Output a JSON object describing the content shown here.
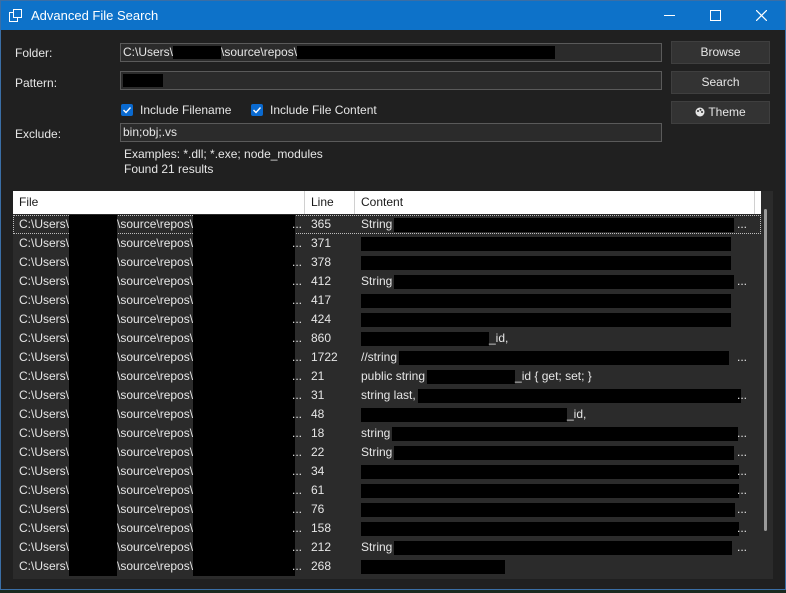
{
  "window": {
    "title": "Advanced File Search",
    "accent": "#0d72c9"
  },
  "form": {
    "folder_label": "Folder:",
    "folder_prefix": "C:\\Users\\",
    "folder_mid": "\\source\\repos\\",
    "pattern_label": "Pattern:",
    "exclude_label": "Exclude:",
    "exclude_value": "bin;obj;.vs",
    "include_filename_label": "Include Filename",
    "include_filename_checked": true,
    "include_content_label": "Include File Content",
    "include_content_checked": true,
    "examples_text": "Examples: *.dll; *.exe; node_modules",
    "results_text": "Found 21 results"
  },
  "buttons": {
    "browse": "Browse",
    "search": "Search",
    "theme": "Theme"
  },
  "table": {
    "columns": [
      "File",
      "Line",
      "Content"
    ],
    "file_prefix": "C:\\Users\\",
    "file_mid": "\\source\\repos\\",
    "ellipsis": "...",
    "rows": [
      {
        "line": "365",
        "pre": "String",
        "post": "",
        "ell": true
      },
      {
        "line": "371",
        "pre": "",
        "post": "",
        "ell": false
      },
      {
        "line": "378",
        "pre": "",
        "post": "",
        "ell": false
      },
      {
        "line": "412",
        "pre": "String",
        "post": "",
        "ell": true
      },
      {
        "line": "417",
        "pre": "",
        "post": "",
        "ell": false
      },
      {
        "line": "424",
        "pre": "",
        "post": "",
        "ell": false
      },
      {
        "line": "860",
        "pre": "",
        "post": "_id,",
        "ell": false
      },
      {
        "line": "1722",
        "pre": "//string",
        "post": "",
        "ell": true
      },
      {
        "line": "21",
        "pre": "public string",
        "post": "_id { get; set; }",
        "ell": false
      },
      {
        "line": "31",
        "pre": "string last,",
        "post": "",
        "ell": true
      },
      {
        "line": "48",
        "pre": "",
        "post": "_id,",
        "ell": false
      },
      {
        "line": "18",
        "pre": "string",
        "post": "",
        "ell": true
      },
      {
        "line": "22",
        "pre": "String",
        "post": "",
        "ell": true
      },
      {
        "line": "34",
        "pre": "",
        "post": "",
        "ell": true
      },
      {
        "line": "61",
        "pre": "",
        "post": "",
        "ell": true
      },
      {
        "line": "76",
        "pre": "",
        "post": "",
        "ell": true
      },
      {
        "line": "158",
        "pre": "",
        "post": "",
        "ell": true
      },
      {
        "line": "212",
        "pre": "String",
        "post": "",
        "ell": true
      },
      {
        "line": "268",
        "pre": "",
        "post": "",
        "ell": false
      }
    ]
  }
}
